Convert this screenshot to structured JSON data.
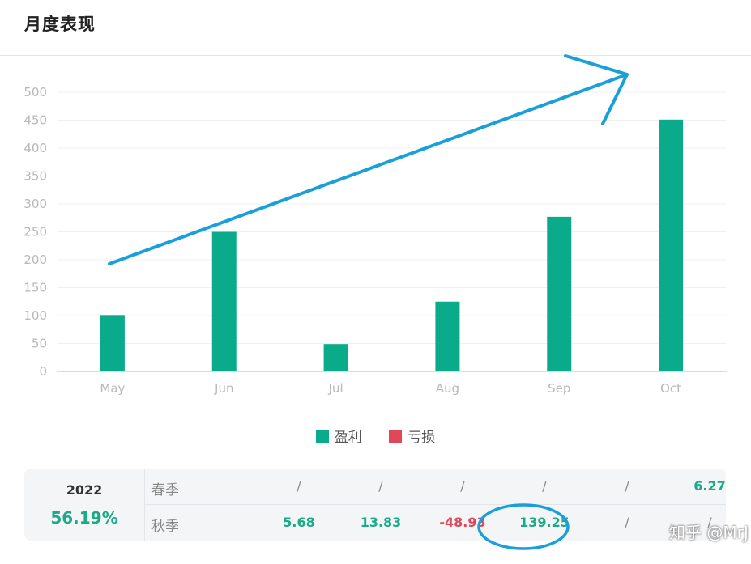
{
  "header": {
    "title": "月度表现"
  },
  "chart_data": {
    "type": "bar",
    "categories": [
      "May",
      "Jun",
      "Jul",
      "Aug",
      "Sep",
      "Oct"
    ],
    "values": [
      101,
      250,
      49,
      125,
      277,
      451
    ],
    "ylim": [
      0,
      500
    ],
    "yticks": [
      0,
      50,
      100,
      150,
      200,
      250,
      300,
      350,
      400,
      450,
      500
    ],
    "grid": true,
    "legend": [
      {
        "name": "盈利",
        "color": "#0aab8a"
      },
      {
        "name": "亏损",
        "color": "#e0485a"
      }
    ],
    "legend_position": "bottom-center"
  },
  "summary": {
    "year": "2022",
    "percent": "56.19%",
    "rows": [
      {
        "label": "春季",
        "cells": [
          "/",
          "/",
          "/",
          "/",
          "/",
          "6.27"
        ]
      },
      {
        "label": "秋季",
        "cells": [
          "5.68",
          "13.83",
          "-48.93",
          "139.25",
          "/",
          "/"
        ]
      }
    ]
  },
  "watermark": "知乎 @MrJ",
  "colors": {
    "accent": "#0aab8a",
    "negative": "#e0485a",
    "annotation": "#1a9fd8"
  }
}
